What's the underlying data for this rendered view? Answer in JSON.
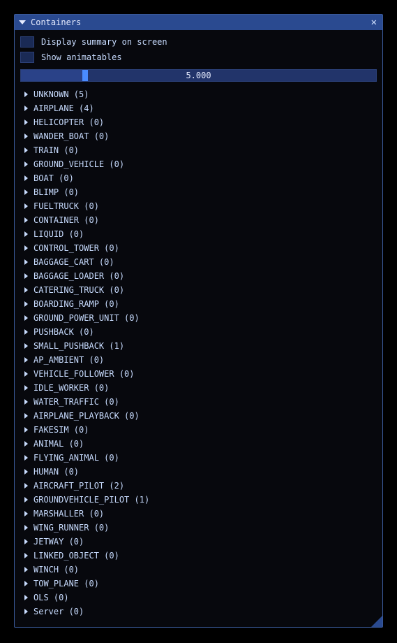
{
  "window": {
    "title": "Containers"
  },
  "options": {
    "display_summary_label": "Display summary on screen",
    "show_animatables_label": "Show animatables"
  },
  "slider": {
    "value_text": "5.000",
    "fill_percent": 18
  },
  "tree": [
    {
      "name": "UNKNOWN",
      "count": 5
    },
    {
      "name": "AIRPLANE",
      "count": 4
    },
    {
      "name": "HELICOPTER",
      "count": 0
    },
    {
      "name": "WANDER_BOAT",
      "count": 0
    },
    {
      "name": "TRAIN",
      "count": 0
    },
    {
      "name": "GROUND_VEHICLE",
      "count": 0
    },
    {
      "name": "BOAT",
      "count": 0
    },
    {
      "name": "BLIMP",
      "count": 0
    },
    {
      "name": "FUELTRUCK",
      "count": 0
    },
    {
      "name": "CONTAINER",
      "count": 0
    },
    {
      "name": "LIQUID",
      "count": 0
    },
    {
      "name": "CONTROL_TOWER",
      "count": 0
    },
    {
      "name": "BAGGAGE_CART",
      "count": 0
    },
    {
      "name": "BAGGAGE_LOADER",
      "count": 0
    },
    {
      "name": "CATERING_TRUCK",
      "count": 0
    },
    {
      "name": "BOARDING_RAMP",
      "count": 0
    },
    {
      "name": "GROUND_POWER_UNIT",
      "count": 0
    },
    {
      "name": "PUSHBACK",
      "count": 0
    },
    {
      "name": "SMALL_PUSHBACK",
      "count": 1
    },
    {
      "name": "AP_AMBIENT",
      "count": 0
    },
    {
      "name": "VEHICLE_FOLLOWER",
      "count": 0
    },
    {
      "name": "IDLE_WORKER",
      "count": 0
    },
    {
      "name": "WATER_TRAFFIC",
      "count": 0
    },
    {
      "name": "AIRPLANE_PLAYBACK",
      "count": 0
    },
    {
      "name": "FAKESIM",
      "count": 0
    },
    {
      "name": "ANIMAL",
      "count": 0
    },
    {
      "name": "FLYING_ANIMAL",
      "count": 0
    },
    {
      "name": "HUMAN",
      "count": 0
    },
    {
      "name": "AIRCRAFT_PILOT",
      "count": 2
    },
    {
      "name": "GROUNDVEHICLE_PILOT",
      "count": 1
    },
    {
      "name": "MARSHALLER",
      "count": 0
    },
    {
      "name": "WING_RUNNER",
      "count": 0
    },
    {
      "name": "JETWAY",
      "count": 0
    },
    {
      "name": "LINKED_OBJECT",
      "count": 0
    },
    {
      "name": "WINCH",
      "count": 0
    },
    {
      "name": "TOW_PLANE",
      "count": 0
    },
    {
      "name": "OLS",
      "count": 0
    },
    {
      "name": "Server",
      "count": 0
    }
  ]
}
